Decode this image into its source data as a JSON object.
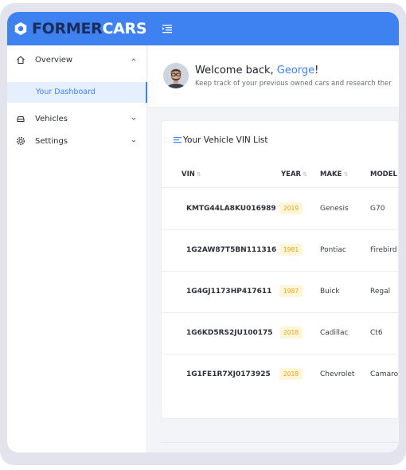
{
  "app": {
    "logo_part1": "FORMER",
    "logo_part2": "CARS"
  },
  "colors": {
    "brand": "#3e82f2",
    "badge_bg": "#fff6d9",
    "badge_text": "#e3a418"
  },
  "sidebar": {
    "items": [
      {
        "label": "Overview",
        "icon": "home-icon",
        "expanded": true
      },
      {
        "label": "Vehicles",
        "icon": "car-icon",
        "expanded": false
      },
      {
        "label": "Settings",
        "icon": "gear-icon",
        "expanded": false
      }
    ],
    "sub_items": [
      {
        "label": "Your Dashboard",
        "active": true
      }
    ]
  },
  "welcome": {
    "greeting": "Welcome back, ",
    "name": "George",
    "exclaim": "!",
    "subtitle": "Keep track of your previous owned cars and research ther"
  },
  "vin_list": {
    "title": "Your Vehicle VIN List",
    "columns": [
      "VIN",
      "YEAR",
      "MAKE",
      "MODEL"
    ],
    "rows": [
      {
        "vin": "KMTG44LA8KU016989",
        "year": "2019",
        "make": "Genesis",
        "model": "G70"
      },
      {
        "vin": "1G2AW87T5BN111316",
        "year": "1981",
        "make": "Pontiac",
        "model": "Firebird"
      },
      {
        "vin": "1G4GJ1173HP417611",
        "year": "1987",
        "make": "Buick",
        "model": "Regal"
      },
      {
        "vin": "1G6KD5RS2JU100175",
        "year": "2018",
        "make": "Cadillac",
        "model": "Ct6"
      },
      {
        "vin": "1G1FE1R7XJ0173925",
        "year": "2018",
        "make": "Chevrolet",
        "model": "Camaro"
      }
    ]
  }
}
